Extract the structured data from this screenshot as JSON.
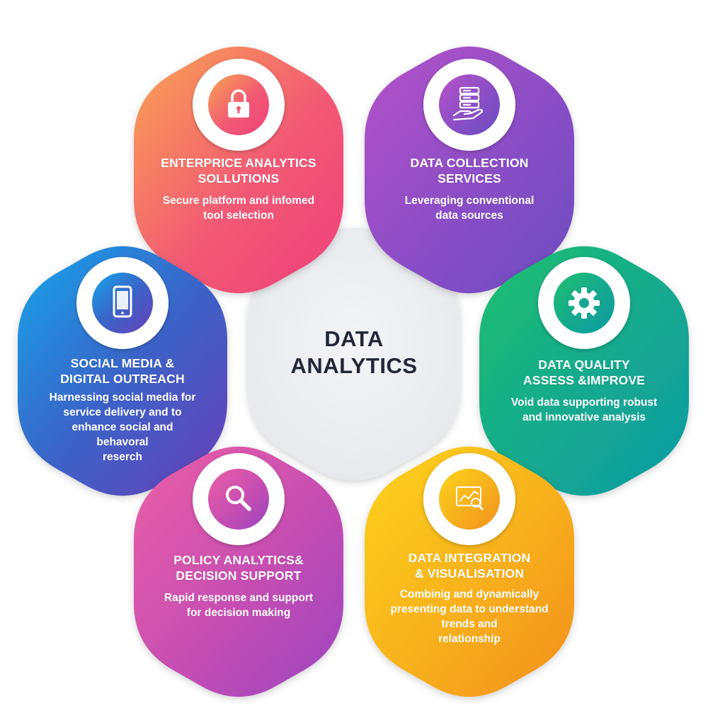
{
  "center": {
    "line1": "DATA",
    "line2": "ANALYTICS"
  },
  "hexagons": [
    {
      "title1": "ENTERPRICE ANALYTICS",
      "title2": "SOLLUTIONS",
      "desc": [
        "Secure platform and infomed",
        "tool selection"
      ],
      "icon": "lock-icon",
      "gradient": [
        "#f9a552",
        "#f25a74",
        "#ee3f7c"
      ]
    },
    {
      "title1": "DATA COLLECTION",
      "title2": "SERVICES",
      "desc": [
        "Leveraging conventional",
        "data sources"
      ],
      "icon": "server-hand-icon",
      "gradient": [
        "#b652c8",
        "#8a4ec6",
        "#6a4cc0"
      ]
    },
    {
      "title1": "SOCIAL MEDIA &",
      "title2": "DIGITAL OUTREACH",
      "desc": [
        "Harnessing social media for",
        "service delivery and to",
        "enhance social and",
        "behavoral",
        "reserch"
      ],
      "icon": "smartphone-icon",
      "gradient": [
        "#16a6ea",
        "#3a64c8",
        "#6a3fb8"
      ]
    },
    {
      "title1": "DATA QUALITY",
      "title2": "ASSESS &IMPROVE",
      "desc": [
        "Void data supporting robust",
        "and innovative analysis"
      ],
      "icon": "gear-icon",
      "gradient": [
        "#1fbf6f",
        "#14a98f",
        "#0e9aa4"
      ]
    },
    {
      "title1": "POLICY ANALYTICS&",
      "title2": "DECISION SUPPORT",
      "desc": [
        "Rapid response and support",
        "for decision making"
      ],
      "icon": "magnifier-icon",
      "gradient": [
        "#ec5fa6",
        "#c64eb2",
        "#9b44c0"
      ]
    },
    {
      "title1": "DATA INTEGRATION",
      "title2": "& VISUALISATION",
      "desc": [
        "Combinig and dynamically",
        "presenting data to understand",
        "trends and",
        "relationship"
      ],
      "icon": "chart-screen-icon",
      "gradient": [
        "#fbd31c",
        "#f8b31c",
        "#f28f1c"
      ]
    }
  ],
  "colors": {
    "center_hex": "#eceef1",
    "center_text": "#222838",
    "icon_circle": "#ffffff"
  }
}
